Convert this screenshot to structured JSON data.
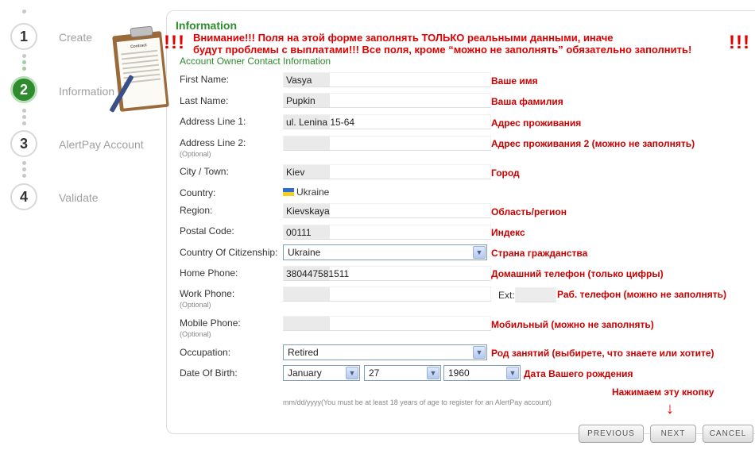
{
  "steps": [
    {
      "number": "1",
      "label": "Create"
    },
    {
      "number": "2",
      "label": "Information"
    },
    {
      "number": "3",
      "label": "AlertPay Account"
    },
    {
      "number": "4",
      "label": "Validate"
    }
  ],
  "clipboard": {
    "title": "Contract"
  },
  "panel": {
    "title": "Information",
    "section": "Account Owner Contact Information",
    "warning_marks": "!!!",
    "warning_line1": "Внимание!!! Поля на этой форме заполнять ТОЛЬКО реальными данными, иначе",
    "warning_line2": "будут проблемы с выплатами!!! Все поля, кроме “можно не заполнять” обязательно заполнить!"
  },
  "form": {
    "optional_text": "(Optional)",
    "first_name": {
      "label": "First Name:",
      "value": "Vasya",
      "note": "Ваше имя"
    },
    "last_name": {
      "label": "Last Name:",
      "value": "Pupkin",
      "note": "Ваша фамилия"
    },
    "address1": {
      "label": "Address Line 1:",
      "value": "ul. Lenina 15-64",
      "note": "Адрес проживания"
    },
    "address2": {
      "label": "Address Line 2:",
      "value": "",
      "note": "Адрес проживания 2 (можно не заполнять)"
    },
    "city": {
      "label": "City / Town:",
      "value": "Kiev",
      "note": "Город"
    },
    "country": {
      "label": "Country:",
      "value": "Ukraine"
    },
    "region": {
      "label": "Region:",
      "value": "Kievskaya",
      "note": "Область/регион"
    },
    "postal": {
      "label": "Postal Code:",
      "value": "00111",
      "note": "Индекс"
    },
    "citizenship": {
      "label": "Country Of Citizenship:",
      "value": "Ukraine",
      "note": "Страна гражданства"
    },
    "home_phone": {
      "label": "Home Phone:",
      "value": "380447581511",
      "note": "Домашний телефон (только цифры)"
    },
    "work_phone": {
      "label": "Work Phone:",
      "value": "",
      "ext_label": "Ext:",
      "note": "Раб. телефон (можно не заполнять)"
    },
    "mobile_phone": {
      "label": "Mobile Phone:",
      "value": "",
      "note": "Мобильный (можно не заполнять)"
    },
    "occupation": {
      "label": "Occupation:",
      "value": "Retired",
      "note": "Род занятий (выбирете, что знаете или хотите)"
    },
    "dob": {
      "label": "Date Of Birth:",
      "month": "January",
      "day": "27",
      "year": "1960",
      "note": "Дата Вашего рождения"
    },
    "dob_hint": "mm/dd/yyyy(You must be at least 18 years of age to register for an AlertPay account)"
  },
  "next_note": "Нажимаем эту кнопку",
  "next_arrow": "↓",
  "dropdown_glyph": "▼",
  "buttons": {
    "previous": "PREVIOUS",
    "next": "NEXT",
    "cancel": "CANCEL"
  },
  "colors": {
    "accent": "#2e8b2e",
    "warning": "#e00000"
  }
}
